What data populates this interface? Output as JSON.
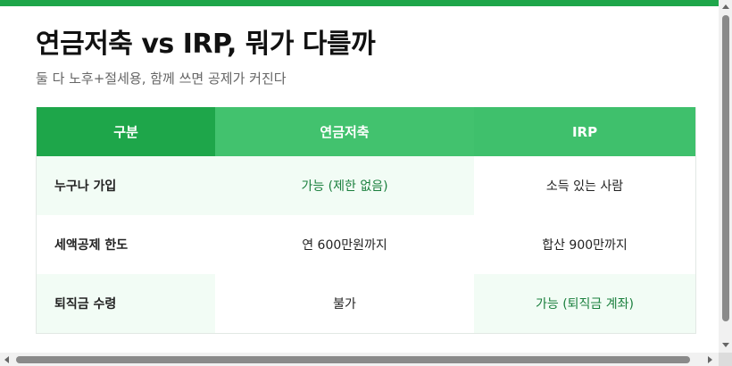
{
  "colors": {
    "accent": "#1ea64a",
    "accent_light": "#42c26e",
    "highlight_bg": "#f2fcf5",
    "highlight_text": "#1a7f3d"
  },
  "page": {
    "title": "연금저축 vs IRP, 뭐가 다를까",
    "subtitle": "둘 다 노후+절세용, 함께 쓰면 공제가 커진다"
  },
  "table": {
    "headers": [
      "구분",
      "연금저축",
      "IRP"
    ],
    "rows": [
      {
        "label": "누구나 가입",
        "a": "가능 (제한 없음)",
        "b": "소득 있는 사람"
      },
      {
        "label": "세액공제 한도",
        "a": "연 600만원까지",
        "b": "합산 900만까지"
      },
      {
        "label": "퇴직금 수령",
        "a": "불가",
        "b": "가능 (퇴직금 계좌)"
      }
    ]
  }
}
